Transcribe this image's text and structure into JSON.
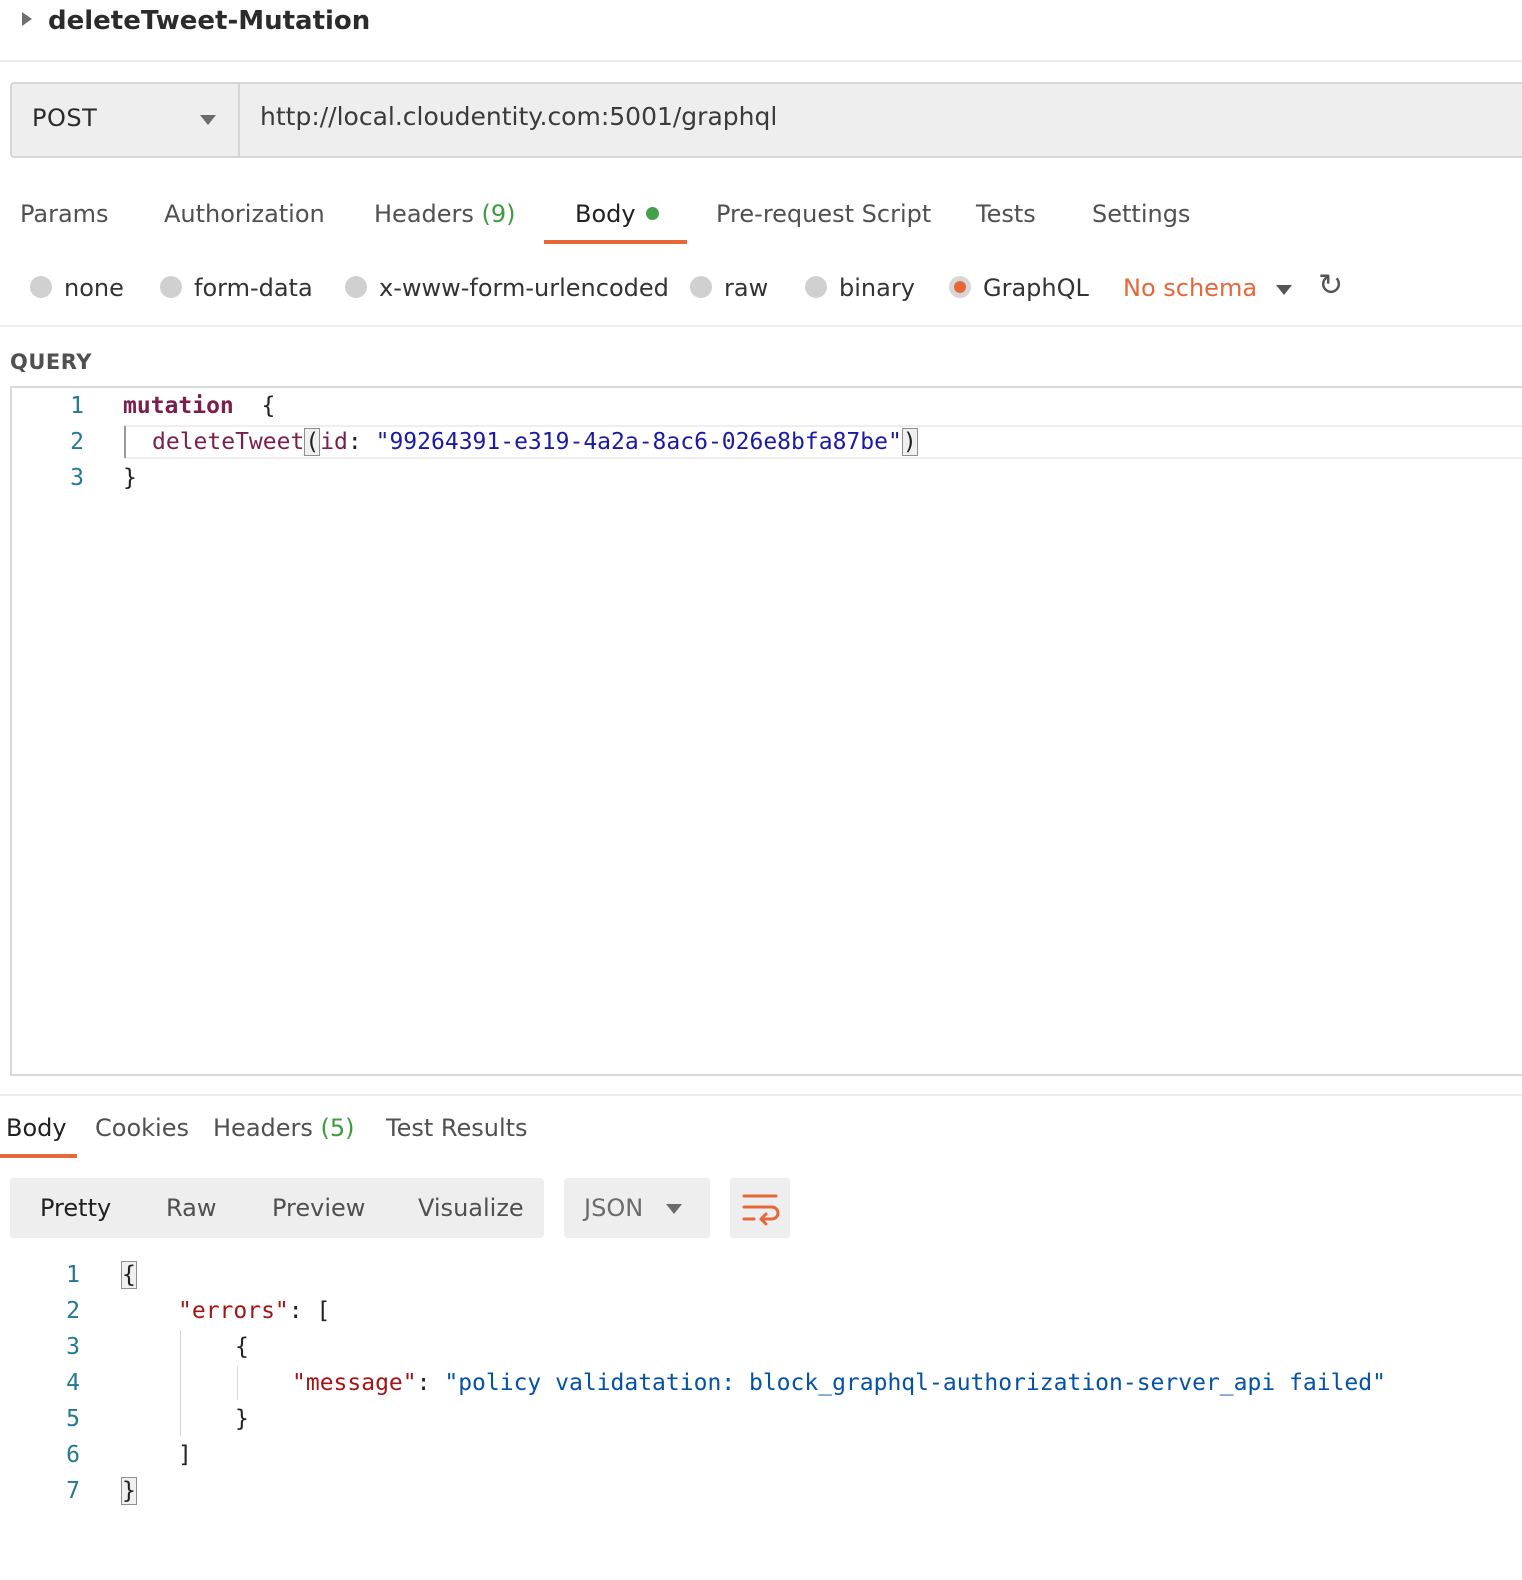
{
  "request": {
    "title": "deleteTweet-Mutation",
    "method": "POST",
    "url": "http://local.cloudentity.com:5001/graphql"
  },
  "request_tabs": [
    {
      "label": "Params"
    },
    {
      "label": "Authorization"
    },
    {
      "label": "Headers",
      "count": "(9)"
    },
    {
      "label": "Body",
      "active": true
    },
    {
      "label": "Pre-request Script"
    },
    {
      "label": "Tests"
    },
    {
      "label": "Settings"
    }
  ],
  "body_types": [
    {
      "label": "none"
    },
    {
      "label": "form-data"
    },
    {
      "label": "x-www-form-urlencoded"
    },
    {
      "label": "raw"
    },
    {
      "label": "binary"
    },
    {
      "label": "GraphQL",
      "selected": true
    }
  ],
  "schema": {
    "label": "No schema"
  },
  "query": {
    "label": "QUERY",
    "line_numbers": [
      "1",
      "2",
      "3"
    ],
    "keyword": "mutation",
    "open_brace": "{",
    "field": "deleteTweet",
    "open_paren": "(",
    "arg_name": "id",
    "colon": ":",
    "arg_value": "\"99264391-e319-4a2a-8ac6-026e8bfa87be\"",
    "close_paren": ")",
    "close_brace": "}"
  },
  "response_tabs": [
    {
      "label": "Body",
      "active": true
    },
    {
      "label": "Cookies"
    },
    {
      "label": "Headers",
      "count": "(5)"
    },
    {
      "label": "Test Results"
    }
  ],
  "response_formats": [
    {
      "label": "Pretty",
      "active": true
    },
    {
      "label": "Raw"
    },
    {
      "label": "Preview"
    },
    {
      "label": "Visualize"
    }
  ],
  "response_language": "JSON",
  "response_body": {
    "line_numbers": [
      "1",
      "2",
      "3",
      "4",
      "5",
      "6",
      "7"
    ],
    "open_brace": "{",
    "errors_key": "\"errors\"",
    "colon": ":",
    "open_bracket": "[",
    "inner_open": "{",
    "message_key": "\"message\"",
    "message_value": "\"policy validatation: block_graphql-authorization-server_api failed\"",
    "inner_close": "}",
    "close_bracket": "]",
    "close_brace": "}"
  },
  "colors": {
    "accent": "#e5673a",
    "count_green": "#3f9b3f",
    "body_dot": "#46a04b"
  },
  "icons": [
    "caret-right-icon",
    "dropdown-caret-icon",
    "refresh-icon",
    "wrap-lines-icon"
  ]
}
